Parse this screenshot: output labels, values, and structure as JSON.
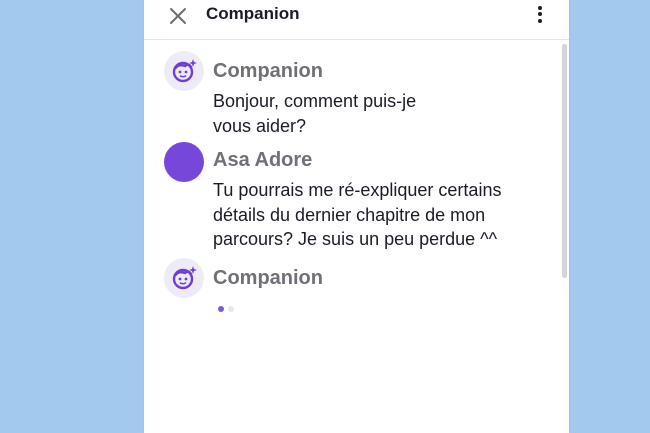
{
  "header": {
    "title": "Companion",
    "close_icon": "close-icon",
    "more_icon": "more-vertical-icon"
  },
  "messages": [
    {
      "sender": "Companion",
      "role": "assistant",
      "avatar_icon": "robot-face-icon",
      "text": "Bonjour, comment puis-je\nvous aider?"
    },
    {
      "sender": "Asa Adore",
      "role": "user",
      "avatar_color": "#7747d9",
      "text": "Tu pourrais me ré-expliquer certains\ndétails du dernier chapitre de mon\nparcours? Je suis un peu perdue ^^"
    },
    {
      "sender": "Companion",
      "role": "assistant",
      "avatar_icon": "robot-face-icon",
      "typing": true
    }
  ],
  "colors": {
    "background": "#a4c9ef",
    "accent": "#7747d9",
    "bot_icon": "#6e3fd2"
  }
}
